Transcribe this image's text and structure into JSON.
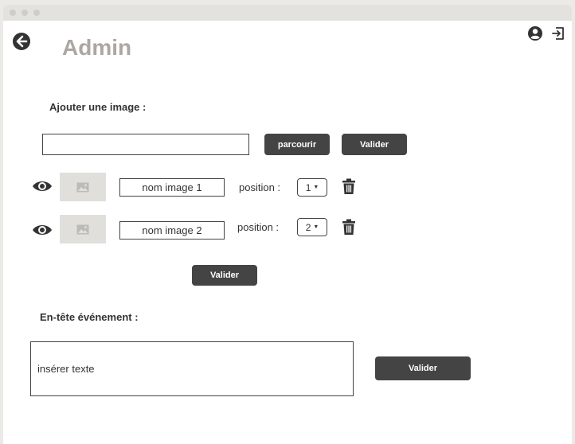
{
  "header": {
    "title": "Admin",
    "back_icon": "arrow-left-circle-icon",
    "account_icon": "user-circle-icon",
    "logout_icon": "logout-icon"
  },
  "add_image": {
    "label": "Ajouter une image :",
    "file_value": "",
    "browse_label": "parcourir",
    "submit_label": "Valider"
  },
  "images": {
    "items": [
      {
        "name": "nom image 1",
        "position_label": "position :",
        "position": "1"
      },
      {
        "name": "nom image 2",
        "position_label": "position :",
        "position": "2"
      }
    ],
    "submit_label": "Valider"
  },
  "event_header": {
    "label": "En-tête événement :",
    "placeholder": "insérer texte",
    "submit_label": "Valider"
  },
  "colors": {
    "button": "#444444",
    "title": "#aba7a1",
    "thumb": "#e0dfdb",
    "chrome": "#e3e2de"
  }
}
